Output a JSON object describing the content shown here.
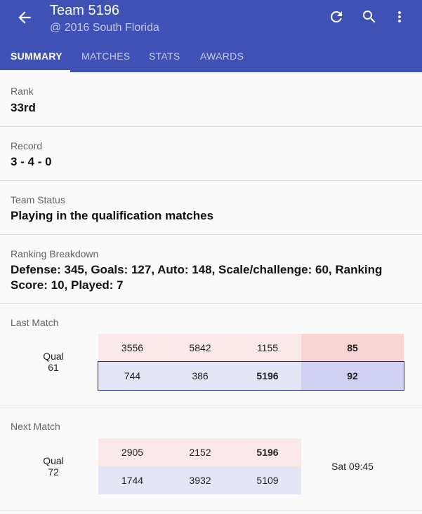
{
  "header": {
    "title": "Team 5196",
    "subtitle": "@ 2016 South Florida",
    "icons": {
      "back": "arrow-back-icon",
      "refresh": "refresh-icon",
      "search": "search-icon",
      "more": "more-vert-icon"
    }
  },
  "tabs": [
    {
      "label": "SUMMARY"
    },
    {
      "label": "MATCHES"
    },
    {
      "label": "STATS"
    },
    {
      "label": "AWARDS"
    }
  ],
  "summary": {
    "rank": {
      "label": "Rank",
      "value": "33rd"
    },
    "record": {
      "label": "Record",
      "value": "3 - 4 - 0"
    },
    "status": {
      "label": "Team Status",
      "value": "Playing in the qualification matches"
    },
    "breakdown": {
      "label": "Ranking Breakdown",
      "line1": "Defense: 345, Goals: 127, Auto: 148, Scale/challenge: 60, Ranking",
      "line2": "Score: 10, Played: 7"
    },
    "last_match": {
      "label": "Last Match",
      "qual_word": "Qual",
      "qual_number": "61",
      "red": {
        "teams": [
          "3556",
          "5842",
          "1155"
        ],
        "score": "85"
      },
      "blue": {
        "teams": [
          "744",
          "386",
          "5196"
        ],
        "score": "92"
      }
    },
    "next_match": {
      "label": "Next Match",
      "qual_word": "Qual",
      "qual_number": "72",
      "red": {
        "teams": [
          "2905",
          "2152",
          "5196"
        ]
      },
      "blue": {
        "teams": [
          "1744",
          "3932",
          "5109"
        ]
      },
      "time": "Sat 09:45"
    }
  },
  "colors": {
    "primary": "#3f51b5",
    "red_alliance": "#fbe9e9",
    "blue_alliance": "#e4e6f6",
    "winner_outline": "#1a237e"
  }
}
